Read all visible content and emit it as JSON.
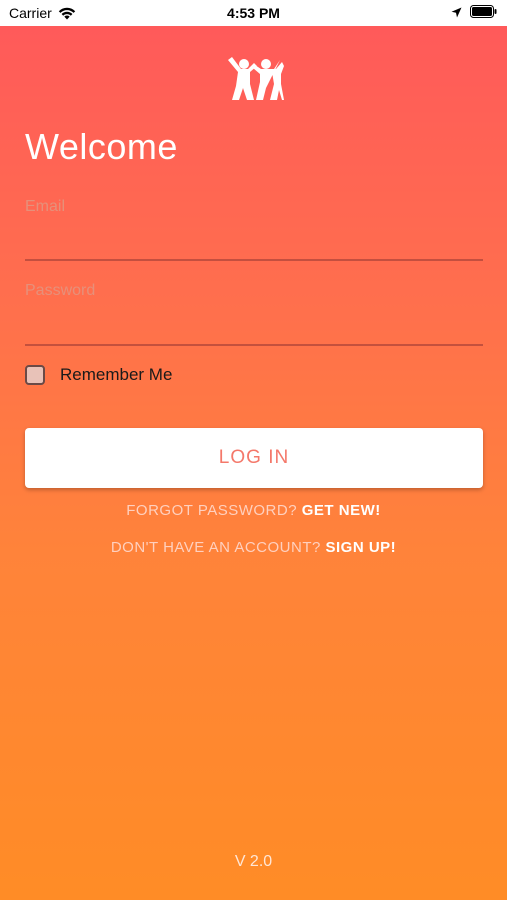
{
  "status_bar": {
    "carrier": "Carrier",
    "time": "4:53 PM",
    "wifi_icon": "wifi-icon",
    "location_icon": "location-arrow-icon",
    "battery_icon": "battery-icon"
  },
  "logo": {
    "icon": "two-children-logo-icon"
  },
  "welcome_title": "Welcome",
  "form": {
    "email_label": "Email",
    "email_value": "",
    "password_label": "Password",
    "password_value": "",
    "remember_label": "Remember Me",
    "remember_checked": false,
    "login_label": "LOG IN"
  },
  "links": {
    "forgot_prefix": "FORGOT PASSWORD?",
    "forgot_action": "GET NEW!",
    "signup_prefix": "DON'T HAVE AN ACCOUNT?",
    "signup_action": "SIGN UP!"
  },
  "version": "V 2.0",
  "colors": {
    "gradient_top": "#ff5a5a",
    "gradient_bottom": "#ff8c26",
    "button_text": "#f4786a"
  }
}
